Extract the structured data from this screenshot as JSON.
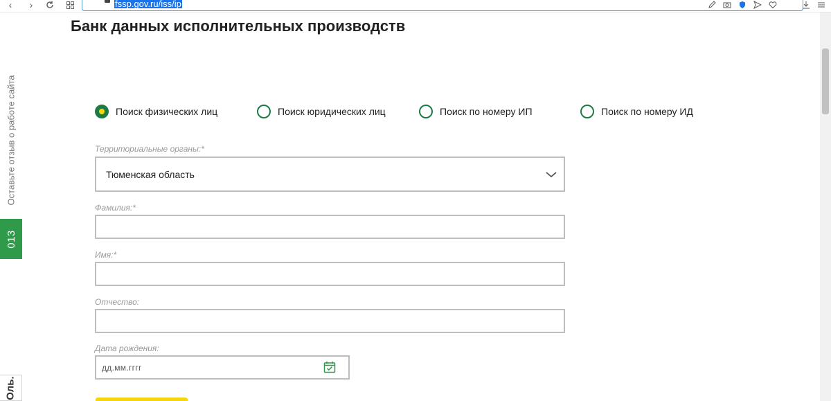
{
  "browser": {
    "url": "fssp.gov.ru/iss/ip"
  },
  "page": {
    "title": "Банк данных исполнительных производств"
  },
  "side": {
    "feedback_text": "Оставьте отзыв о работе сайта",
    "badge": "013",
    "bottom_tab": "Оль."
  },
  "search_types": [
    {
      "label": "Поиск физических лиц",
      "selected": true
    },
    {
      "label": "Поиск юридических лиц",
      "selected": false
    },
    {
      "label": "Поиск по номеру ИП",
      "selected": false
    },
    {
      "label": "Поиск по номеру ИД",
      "selected": false
    }
  ],
  "form": {
    "region_label": "Территориальные органы:*",
    "region_value": "Тюменская область",
    "lastname_label": "Фамилия:*",
    "lastname_value": "",
    "firstname_label": "Имя:*",
    "firstname_value": "",
    "patronymic_label": "Отчество:",
    "patronymic_value": "",
    "birthdate_label": "Дата рождения:",
    "birthdate_placeholder": "дд.мм.гггг"
  },
  "colors": {
    "accent_green": "#1e7a44",
    "badge_green": "#2e9a4a",
    "accent_yellow": "#f5d60e",
    "url_highlight": "#1a73e8"
  }
}
